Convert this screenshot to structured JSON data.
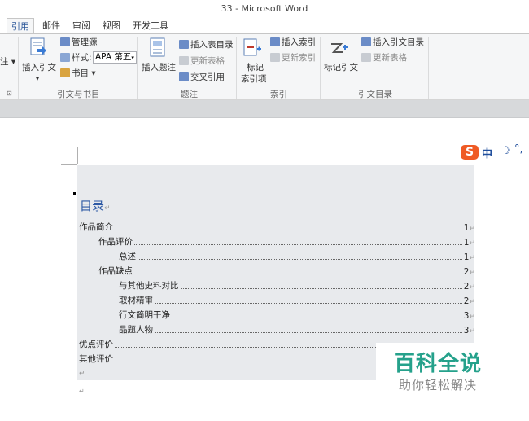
{
  "window": {
    "title": "33 - Microsoft Word"
  },
  "tabs": [
    {
      "label": "引用",
      "active": true
    },
    {
      "label": "邮件"
    },
    {
      "label": "审阅"
    },
    {
      "label": "视图"
    },
    {
      "label": "开发工具"
    }
  ],
  "ribbon": {
    "footnote_group": {
      "partial_label": "注",
      "launcher": "⊡"
    },
    "citations": {
      "insert_citation": "插入引文",
      "manage_sources": "管理源",
      "style_label": "样式:",
      "style_value": "APA 第五",
      "bibliography": "书目",
      "group_label": "引文与书目"
    },
    "captions": {
      "insert_caption": "插入题注",
      "insert_table_of_figures": "插入表目录",
      "update_table": "更新表格",
      "cross_reference": "交叉引用",
      "group_label": "题注"
    },
    "index": {
      "mark_entry_line1": "标记",
      "mark_entry_line2": "索引项",
      "insert_index": "插入索引",
      "update_index": "更新索引",
      "group_label": "索引"
    },
    "authorities": {
      "mark_citation": "标记引文",
      "insert_table_of_authorities": "插入引文目录",
      "update_table": "更新表格",
      "group_label": "引文目录"
    }
  },
  "ime": {
    "logo": "S",
    "mode": "中",
    "moon": "☽",
    "punct": "°,"
  },
  "document": {
    "toc_title": "目录",
    "paragraph_mark": "↵",
    "toc_entries": [
      {
        "text": "作品简介",
        "page": "1",
        "level": 1
      },
      {
        "text": "作品评价",
        "page": "1",
        "level": 2
      },
      {
        "text": "总述",
        "page": "1",
        "level": 3
      },
      {
        "text": "作品缺点",
        "page": "2",
        "level": 2
      },
      {
        "text": "与其他史料对比",
        "page": "2",
        "level": 3
      },
      {
        "text": "取材精审",
        "page": "2",
        "level": 3
      },
      {
        "text": "行文简明干净",
        "page": "3",
        "level": 3
      },
      {
        "text": "品题人物",
        "page": "3",
        "level": 3
      },
      {
        "text": "优点评价",
        "page": "",
        "level": 1
      },
      {
        "text": "其他评价",
        "page": "",
        "level": 1
      }
    ]
  },
  "watermark": {
    "line1": "百科全说",
    "line2": "助你轻松解决",
    "color": "#25a18b"
  }
}
